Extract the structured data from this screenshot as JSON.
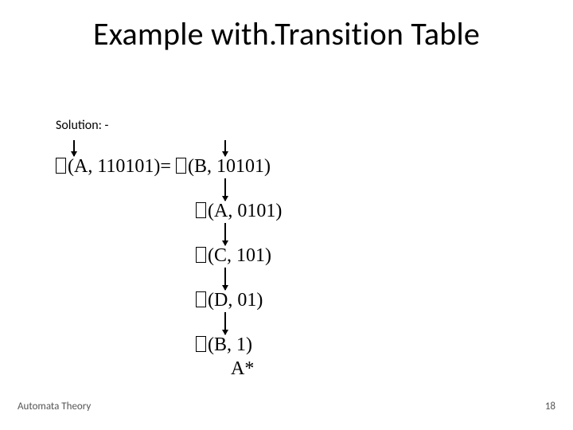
{
  "title": "Example with.Transition Table",
  "solution_label": "Solution: -",
  "steps": {
    "s0_pre": "(A, 110101)= ",
    "s0_post": "(B, 10101)",
    "s1": "(A, 0101)",
    "s2": "(C, 101)",
    "s3": "(D, 01)",
    "s4": "(B, 1)",
    "final": "A*"
  },
  "footer_left": "Automata Theory",
  "footer_right": "18"
}
